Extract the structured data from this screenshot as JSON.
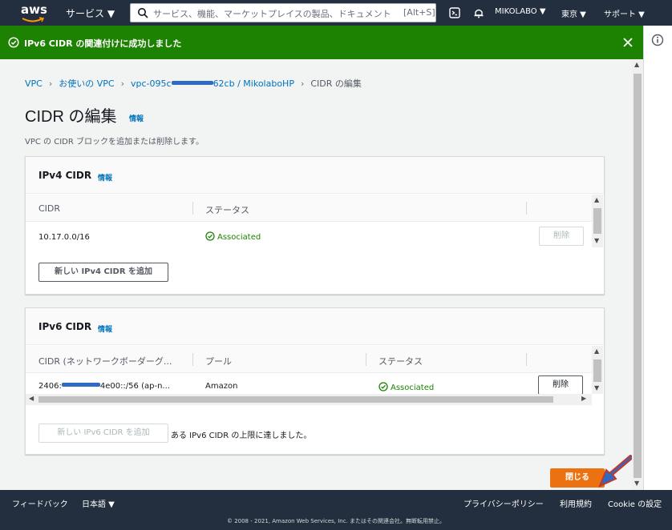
{
  "topnav": {
    "logo": "aws",
    "services": "サービス ▼",
    "search_placeholder": "サービス、機能、マーケットプレイスの製品、ドキュメント",
    "search_shortcut": "[Alt+S]",
    "account": "MIKOLABO ▼",
    "region": "東京 ▼",
    "support": "サポート ▼"
  },
  "flash": {
    "message": "IPv6 CIDR の関連付けに成功しました"
  },
  "breadcrumb": {
    "items": [
      "VPC",
      "お使いの VPC",
      "vpc-095c",
      "62cb / MikolaboHP",
      "CIDR の編集"
    ]
  },
  "page": {
    "title": "CIDR の編集",
    "info": "情報",
    "subtitle": "VPC の CIDR ブロックを追加または削除します。"
  },
  "ipv4": {
    "title": "IPv4 CIDR",
    "info": "情報",
    "columns": [
      "CIDR",
      "ステータス"
    ],
    "rows": [
      {
        "cidr": "10.17.0.0/16",
        "status": "Associated",
        "remove": "削除"
      }
    ],
    "add_button": "新しい IPv4 CIDR を追加"
  },
  "ipv6": {
    "title": "IPv6 CIDR",
    "info": "情報",
    "columns": [
      "CIDR (ネットワークボーダーグ...",
      "プール",
      "ステータス"
    ],
    "rows": [
      {
        "cidr_prefix": "2406:",
        "cidr_suffix": "4e00::/56 (ap-n...",
        "pool": "Amazon",
        "status": "Associated",
        "remove": "削除"
      }
    ],
    "add_button": "新しい IPv6 CIDR を追加",
    "limit_message": "ある IPv6 CIDR の上限に達しました。"
  },
  "actions": {
    "close": "閉じる"
  },
  "footer": {
    "feedback": "フィードバック",
    "language": "日本語 ▼",
    "privacy": "プライバシーポリシー",
    "terms": "利用規約",
    "cookie": "Cookie の設定",
    "copyright": "© 2008 - 2021, Amazon Web Services, Inc. またはその関連会社。無断転用禁止。"
  },
  "colors": {
    "nav_bg": "#232f3e",
    "flash_success": "#1d8102",
    "primary_button": "#ec7211",
    "link": "#0073bb",
    "annotation_arrow": "#2e6bc4"
  }
}
